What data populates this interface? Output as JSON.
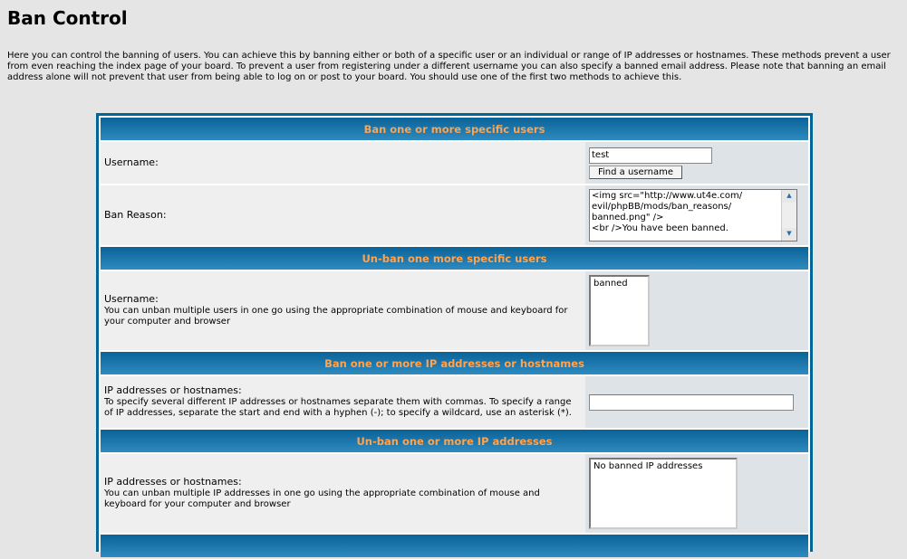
{
  "title": "Ban Control",
  "intro": "Here you can control the banning of users. You can achieve this by banning either or both of a specific user or an individual or range of IP addresses or hostnames. These methods prevent a user from even reaching the index page of your board. To prevent a user from registering under a different username you can also specify a banned email address. Please note that banning an email address alone will not prevent that user from being able to log on or post to your board. You should use one of the first two methods to achieve this.",
  "ban_users": {
    "header": "Ban one or more specific users",
    "username_label": "Username:",
    "username_value": "test",
    "find_button": "Find a username",
    "reason_label": "Ban Reason:",
    "reason_value": "<img src=\"http://www.ut4e.com/\nevil/phpBB/mods/ban_reasons/\nbanned.png\" />\n<br />You have been banned."
  },
  "unban_users": {
    "header": "Un-ban one more specific users",
    "label": "Username:",
    "help": "You can unban multiple users in one go using the appropriate combination of mouse and keyboard for your computer and browser",
    "options": [
      "banned"
    ]
  },
  "ban_ip": {
    "header": "Ban one or more IP addresses or hostnames",
    "label": "IP addresses or hostnames:",
    "help": "To specify several different IP addresses or hostnames separate them with commas. To specify a range of IP addresses, separate the start and end with a hyphen (-); to specify a wildcard, use an asterisk (*).",
    "value": ""
  },
  "unban_ip": {
    "header": "Un-ban one or more IP addresses",
    "label": "IP addresses or hostnames:",
    "help": "You can unban multiple IP addresses in one go using the appropriate combination of mouse and keyboard for your computer and browser",
    "options": [
      "No banned IP addresses"
    ]
  }
}
